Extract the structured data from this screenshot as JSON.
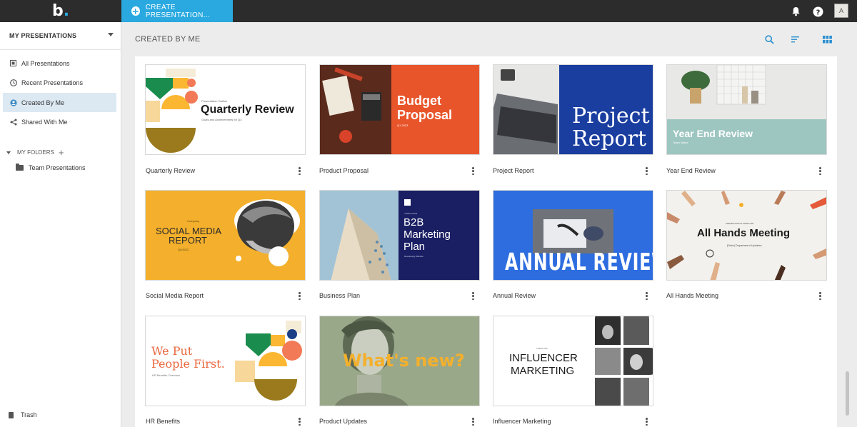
{
  "app": {
    "logo_letter": "b",
    "logo_dot": "."
  },
  "topbar": {
    "create_button": "CREATE PRESENTATION...",
    "icons": [
      "plus-icon",
      "bell-icon",
      "help-icon"
    ],
    "avatar_initial": "A"
  },
  "sidebar": {
    "title": "MY PRESENTATIONS",
    "items": [
      {
        "label": "All Presentations",
        "icon": "all-icon",
        "active": false
      },
      {
        "label": "Recent Presentations",
        "icon": "clock-icon",
        "active": false
      },
      {
        "label": "Created By Me",
        "icon": "user-icon",
        "active": true
      },
      {
        "label": "Shared With Me",
        "icon": "share-icon",
        "active": false
      }
    ],
    "folders_label": "MY FOLDERS",
    "folders": [
      "Team Presentations"
    ],
    "trash_label": "Trash"
  },
  "main": {
    "title": "CREATED BY ME",
    "tools": [
      "search-icon",
      "sort-icon",
      "grid-view-icon"
    ]
  },
  "presentations": [
    {
      "name": "Quarterly Review",
      "thumb": {
        "title": "Quarterly Review",
        "small": "Presentation Outline",
        "sub": "Goals and Achievements for Q3"
      }
    },
    {
      "name": "Product Proposal",
      "thumb": {
        "title_line1": "Budget",
        "title_line2": "Proposal",
        "sub": "Q1 2023"
      }
    },
    {
      "name": "Project Report",
      "thumb": {
        "title_line1": "Project",
        "title_line2": "Report"
      }
    },
    {
      "name": "Year End Review",
      "thumb": {
        "title": "Year End Review",
        "sub": "Team Name"
      }
    },
    {
      "name": "Social Media Report",
      "thumb": {
        "small": "Company",
        "title_line1": "SOCIAL MEDIA",
        "title_line2": "REPORT",
        "sub": "Q4/2022"
      }
    },
    {
      "name": "Business Plan",
      "thumb": {
        "small": "YOUR LOGO",
        "title_line1": "B2B",
        "title_line2": "Marketing",
        "title_line3": "Plan",
        "sub": "Developing Website"
      }
    },
    {
      "name": "Annual Review",
      "thumb": {
        "title": "ANNUAL REVIEW"
      }
    },
    {
      "name": "All Hands Meeting",
      "thumb": {
        "small": "PRESENTATION TEMPLATE",
        "title": "All Hands Meeting",
        "sub": "[Date] Department Updates"
      }
    },
    {
      "name": "HR Benefits",
      "thumb": {
        "title_line1": "We Put",
        "title_line2": "People First.",
        "sub": "HR Benefits Overview"
      }
    },
    {
      "name": "Product Updates",
      "thumb": {
        "title": "What's new?"
      }
    },
    {
      "name": "Influencer Marketing",
      "thumb": {
        "small": "TEMPLATE",
        "title_line1": "INFLUENCER",
        "title_line2": "MARKETING"
      }
    }
  ],
  "colors": {
    "accent": "#2aa9e0",
    "topbar": "#2c2c2c",
    "active_item": "#dce9f3",
    "budget_orange": "#e9552b",
    "project_blue": "#1a3ea0",
    "social_yellow": "#f4b02c",
    "b2b_navy": "#1a1f63",
    "annual_blue": "#2d6ddf",
    "hr_orange": "#e8683e",
    "updates_green": "#7e8f6b"
  }
}
